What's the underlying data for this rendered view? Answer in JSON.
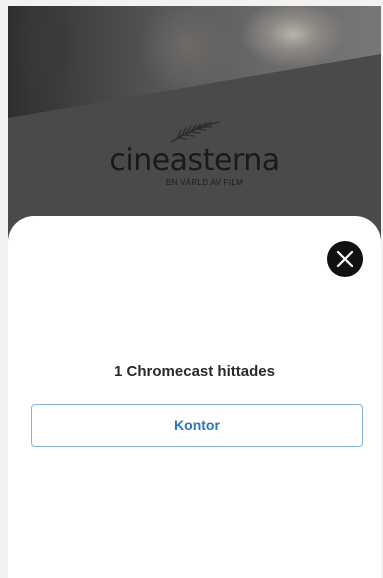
{
  "brand": {
    "name": "cineasterna",
    "tagline": "EN VÄRLD AV FILM"
  },
  "dialog": {
    "found_text": "1 Chromecast hittades",
    "devices": [
      {
        "label": "Kontor"
      }
    ]
  },
  "icons": {
    "close": "close-icon",
    "logo_feather": "palm-feather-icon"
  },
  "colors": {
    "sheet_background": "#ffffff",
    "close_button": "#111111",
    "device_text": "#2f73b8",
    "device_border": "#8ab2d9",
    "backdrop": "#4a4a4a"
  }
}
